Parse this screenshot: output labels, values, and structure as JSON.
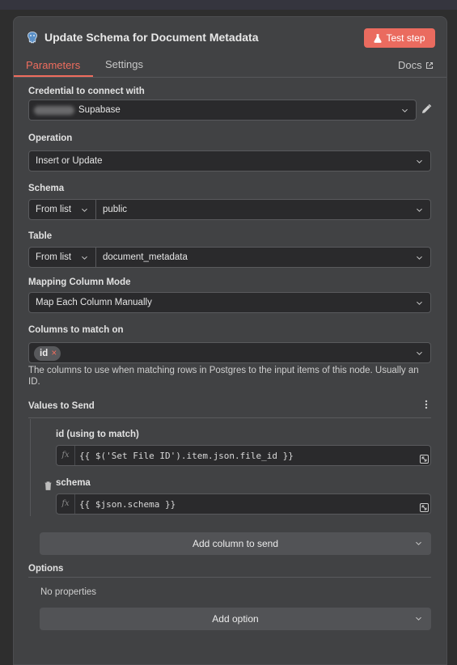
{
  "header": {
    "title": "Update Schema for Document Metadata",
    "test_button": "Test step",
    "node_icon": "postgres-elephant-icon"
  },
  "tabs": [
    {
      "label": "Parameters",
      "active": true
    },
    {
      "label": "Settings",
      "active": false
    }
  ],
  "docs_link": "Docs",
  "fields": {
    "credential": {
      "label": "Credential to connect with",
      "value": "Supabase"
    },
    "operation": {
      "label": "Operation",
      "value": "Insert or Update"
    },
    "schema": {
      "label": "Schema",
      "mode": "From list",
      "value": "public"
    },
    "table": {
      "label": "Table",
      "mode": "From list",
      "value": "document_metadata"
    },
    "mapping_mode": {
      "label": "Mapping Column Mode",
      "value": "Map Each Column Manually"
    },
    "match_columns": {
      "label": "Columns to match on",
      "chips": [
        "id"
      ],
      "help": "The columns to use when matching rows in Postgres to the input items of this node. Usually an ID."
    }
  },
  "values_to_send": {
    "title": "Values to Send",
    "rows": [
      {
        "label": "id (using to match)",
        "expression": "{{ $('Set File ID').item.json.file_id }}"
      },
      {
        "label": "schema",
        "expression": "{{ $json.schema }}"
      }
    ],
    "add_button": "Add column to send"
  },
  "options": {
    "title": "Options",
    "empty_text": "No properties",
    "add_button": "Add option"
  },
  "fx_label": "fx",
  "colors": {
    "accent": "#ef6d5e",
    "test_button_bg": "#ea6b5f",
    "panel_bg": "#414244",
    "input_bg": "#2a2a2c"
  }
}
